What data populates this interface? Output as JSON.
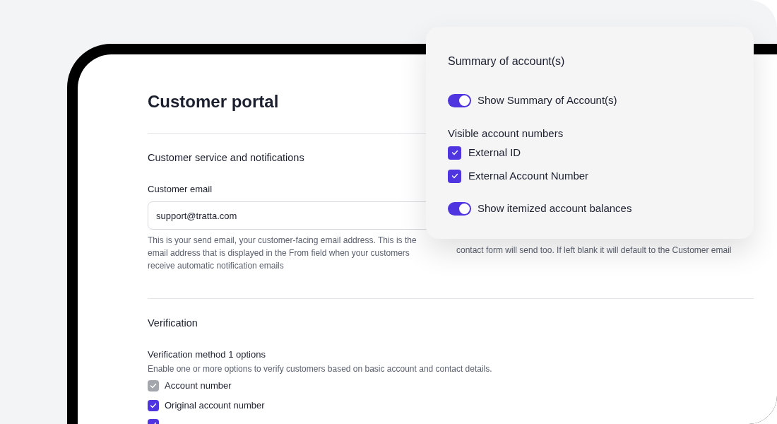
{
  "page": {
    "title": "Customer portal"
  },
  "service_section": {
    "heading": "Customer service and notifications",
    "email_label": "Customer email",
    "email_value": "support@tratta.com",
    "email_help": "This is your send email, your customer-facing email address. This is the email address that is displayed in the From field when your customers receive automatic notification emails",
    "contact_help": "contact form will send too. If left blank it will default to the Customer email"
  },
  "verification_section": {
    "heading": "Verification",
    "method_label": "Verification method 1 options",
    "method_help": "Enable one or more options to verify customers based on basic account and contact details.",
    "options": [
      {
        "label": "Account number",
        "checked": true,
        "disabled": true
      },
      {
        "label": "Original account number",
        "checked": true,
        "disabled": false
      },
      {
        "checked": true,
        "disabled": false
      }
    ]
  },
  "popup": {
    "title": "Summary of account(s)",
    "items": [
      {
        "kind": "toggle",
        "label": "Show Summary of Account(s)",
        "on": true
      },
      {
        "kind": "heading",
        "label": "Visible account numbers"
      },
      {
        "kind": "checkbox",
        "label": "External ID",
        "checked": true
      },
      {
        "kind": "checkbox",
        "label": "External Account Number",
        "checked": true
      },
      {
        "kind": "toggle",
        "label": "Show itemized account balances",
        "on": true
      }
    ]
  }
}
